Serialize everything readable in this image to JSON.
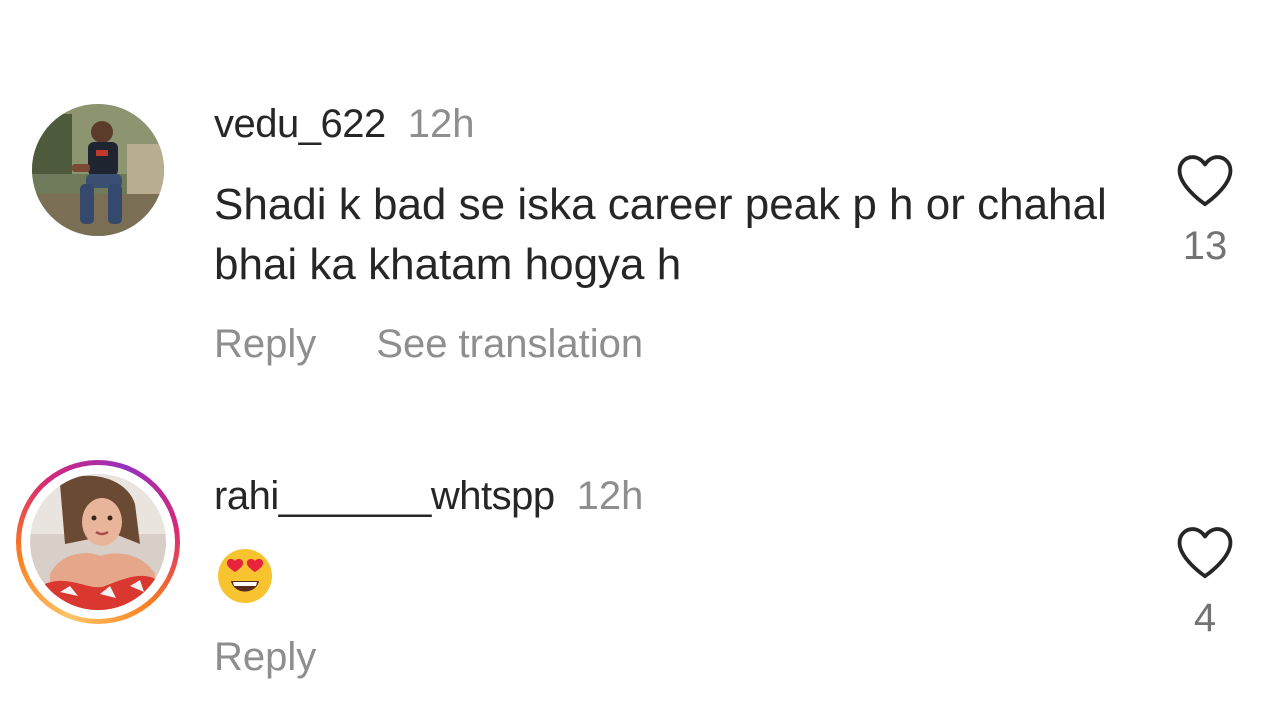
{
  "comments": [
    {
      "username": "vedu_622",
      "timestamp": "12h",
      "text": "Shadi k bad se iska career peak p h or chahal bhai ka khatam hogya h",
      "reply_label": "Reply",
      "translation_label": "See translation",
      "like_count": "13",
      "has_story_ring": false
    },
    {
      "username": "rahi_______whtspp",
      "timestamp": "12h",
      "emoji": "heart-eyes-emoji",
      "reply_label": "Reply",
      "like_count": "4",
      "has_story_ring": true
    }
  ],
  "colors": {
    "primary_text": "#262626",
    "secondary_text": "#8e8e8e",
    "story_ring": [
      "#fdc468",
      "#fa7e1e",
      "#d62976",
      "#962fbf"
    ]
  }
}
